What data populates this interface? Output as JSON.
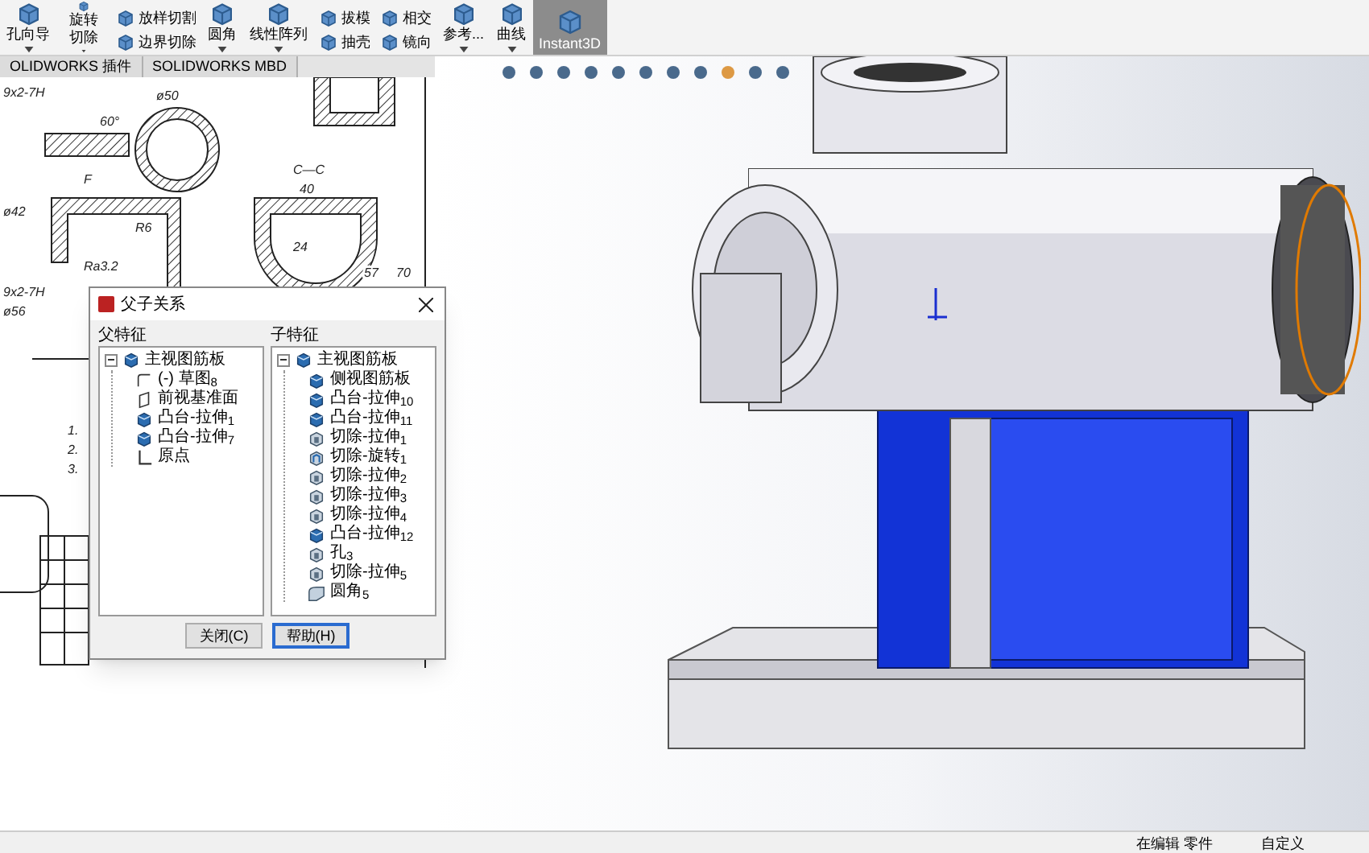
{
  "toolbar": [
    {
      "kind": "big",
      "label": "孔向导",
      "selected": false
    },
    {
      "kind": "big",
      "label": "旋转切除",
      "selected": false
    },
    {
      "kind": "stack",
      "items": [
        "放样切割",
        "边界切除"
      ]
    },
    {
      "kind": "big",
      "label": "圆角",
      "selected": false
    },
    {
      "kind": "big",
      "label": "线性阵列",
      "selected": false
    },
    {
      "kind": "stack",
      "items": [
        "拔模",
        "抽壳"
      ]
    },
    {
      "kind": "stack",
      "items": [
        "相交",
        "镜向"
      ]
    },
    {
      "kind": "big",
      "label": "参考...",
      "selected": false
    },
    {
      "kind": "big",
      "label": "曲线",
      "selected": false
    },
    {
      "kind": "big",
      "label": "Instant3D",
      "selected": true
    }
  ],
  "tabs": [
    {
      "label": "OLIDWORKS 插件",
      "selected": false
    },
    {
      "label": "SOLIDWORKS MBD",
      "selected": false
    }
  ],
  "drawing": {
    "labels": [
      "9x2-7H",
      "ø50",
      "60°",
      "F",
      "ø42",
      "R6",
      "Ra3.2",
      "9x2-7H",
      "ø56",
      "C—C",
      "40",
      "24",
      "57",
      "70",
      "1.",
      "2.",
      "3."
    ]
  },
  "dialog": {
    "title": "父子关系",
    "parent_label": "父特征",
    "parents": [
      {
        "label": "主视图筋板",
        "kind": "boss",
        "expanded": true,
        "children": [
          {
            "label": "(-) 草图$_{8}$",
            "kind": "sketch"
          },
          {
            "label": "前视基准面",
            "kind": "plane"
          },
          {
            "label": "凸台-拉伸$_{1}$",
            "kind": "boss"
          },
          {
            "label": "凸台-拉伸$_{7}$",
            "kind": "boss"
          },
          {
            "label": "原点",
            "kind": "origin"
          }
        ]
      }
    ],
    "child_label": "子特征",
    "children": [
      {
        "label": "主视图筋板",
        "kind": "boss",
        "expanded": true,
        "children": [
          {
            "label": "侧视图筋板",
            "kind": "boss"
          },
          {
            "label": "凸台-拉伸$_{10}$",
            "kind": "boss"
          },
          {
            "label": "凸台-拉伸$_{11}$",
            "kind": "boss"
          },
          {
            "label": "切除-拉伸$_{1}$",
            "kind": "cut"
          },
          {
            "label": "切除-旋转$_{1}$",
            "kind": "revolve"
          },
          {
            "label": "切除-拉伸$_{2}$",
            "kind": "cut"
          },
          {
            "label": "切除-拉伸$_{3}$",
            "kind": "cut"
          },
          {
            "label": "切除-拉伸$_{4}$",
            "kind": "cut"
          },
          {
            "label": "凸台-拉伸$_{12}$",
            "kind": "boss"
          },
          {
            "label": "孔$_{3}$",
            "kind": "cut"
          },
          {
            "label": "切除-拉伸$_{5}$",
            "kind": "cut"
          },
          {
            "label": "圆角$_{5}$",
            "kind": "fillet"
          }
        ]
      }
    ],
    "buttons": [
      {
        "label": "关闭(C)",
        "default": false
      },
      {
        "label": "帮助(H)",
        "default": true
      }
    ]
  },
  "status_bar": [
    "在编辑 零件",
    "自定义"
  ]
}
